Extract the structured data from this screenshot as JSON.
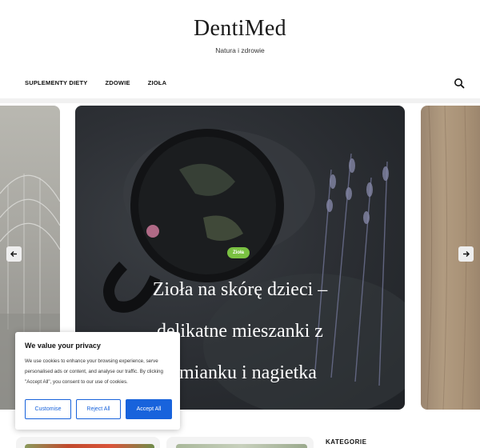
{
  "site": {
    "title": "DentiMed",
    "tagline": "Natura i zdrowie"
  },
  "nav": {
    "items": [
      {
        "label": "SUPLEMENTY DIETY"
      },
      {
        "label": "ZDOWIE"
      },
      {
        "label": "ZIOŁA"
      }
    ],
    "search_icon": "search-icon"
  },
  "slider": {
    "featured": {
      "category": "Zioła",
      "title": "Zioła na skórę dzieci – delikatne mieszanki z rumianku i nagietka"
    },
    "prev_icon": "arrow-left-icon",
    "next_icon": "arrow-right-icon"
  },
  "sidebar": {
    "heading": "KATEGORIE"
  },
  "cookie_banner": {
    "title": "We value your privacy",
    "text": "We use cookies to enhance your browsing experience, serve personalised ads or content, and analyse our traffic. By clicking \"Accept All\", you consent to our use of cookies.",
    "buttons": {
      "customise": "Customise",
      "reject": "Reject All",
      "accept": "Accept All"
    }
  },
  "colors": {
    "accent_green": "#7ac142",
    "cookie_blue": "#1863dc"
  }
}
